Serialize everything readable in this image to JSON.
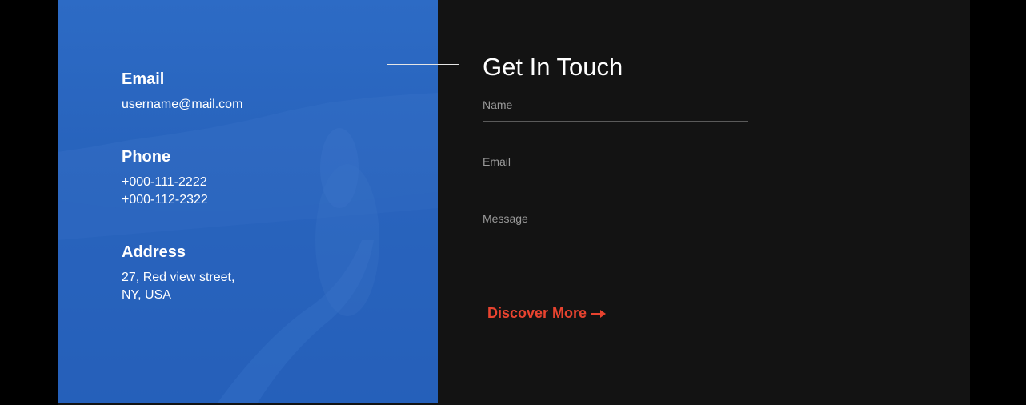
{
  "contact_info": {
    "email": {
      "heading": "Email",
      "value": "username@mail.com"
    },
    "phone": {
      "heading": "Phone",
      "lines": [
        "+000-111-2222",
        "+000-112-2322"
      ]
    },
    "address": {
      "heading": "Address",
      "lines": [
        "27, Red view street,",
        "NY, USA"
      ]
    }
  },
  "form": {
    "title": "Get In Touch",
    "name_placeholder": "Name",
    "email_placeholder": "Email",
    "message_placeholder": "Message",
    "cta_label": "Discover More",
    "cta_icon": "arrow-right-icon"
  },
  "colors": {
    "info_panel": "#2762bb",
    "form_background": "#131313",
    "accent": "#e8432f"
  }
}
